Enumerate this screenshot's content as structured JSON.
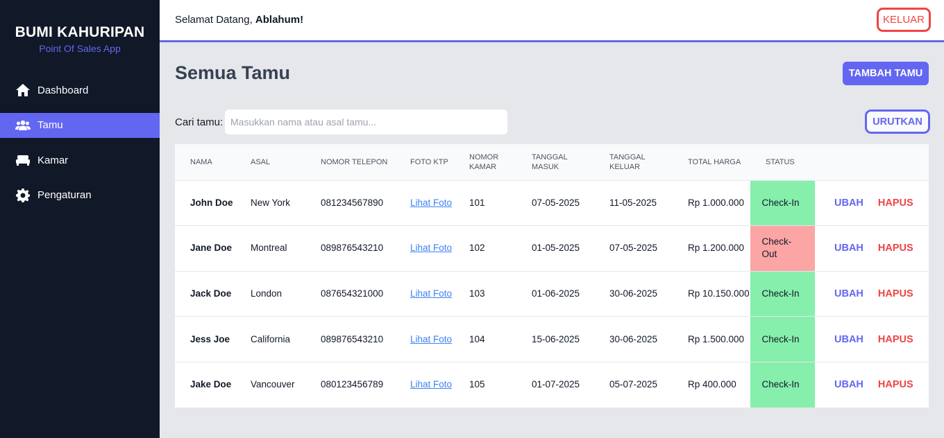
{
  "brand": {
    "title": "BUMI KAHURIPAN",
    "subtitle": "Point Of Sales App"
  },
  "sidebar": {
    "items": [
      {
        "label": "Dashboard",
        "icon": "home-icon",
        "active": false
      },
      {
        "label": "Tamu",
        "icon": "users-icon",
        "active": true
      },
      {
        "label": "Kamar",
        "icon": "bed-icon",
        "active": false
      },
      {
        "label": "Pengaturan",
        "icon": "gear-icon",
        "active": false
      }
    ]
  },
  "header": {
    "greeting_prefix": "Selamat Datang, ",
    "user_name": "Ablahum!",
    "logout_label": "KELUAR"
  },
  "page": {
    "title": "Semua Tamu",
    "add_label": "TAMBAH TAMU",
    "sort_label": "URUTKAN"
  },
  "search": {
    "label": "Cari tamu:",
    "placeholder": "Masukkan nama atau asal tamu...",
    "value": ""
  },
  "table": {
    "columns": [
      "NAMA",
      "ASAL",
      "NOMOR TELEPON",
      "FOTO KTP",
      "NOMOR KAMAR",
      "TANGGAL MASUK",
      "TANGGAL KELUAR",
      "TOTAL HARGA",
      "STATUS",
      ""
    ],
    "rows": [
      {
        "name": "John Doe",
        "origin": "New York",
        "phone": "081234567890",
        "photo": "Lihat Foto",
        "room": "101",
        "check_in": "07-05-2025",
        "check_out": "11-05-2025",
        "total": "Rp 1.000.000",
        "status": "Check-In",
        "status_color": "#86efac",
        "edit": "UBAH",
        "delete": "HAPUS"
      },
      {
        "name": "Jane Doe",
        "origin": "Montreal",
        "phone": "089876543210",
        "photo": "Lihat Foto",
        "room": "102",
        "check_in": "01-05-2025",
        "check_out": "07-05-2025",
        "total": "Rp 1.200.000",
        "status": "Check-Out",
        "status_color": "#fca5a5",
        "edit": "UBAH",
        "delete": "HAPUS"
      },
      {
        "name": "Jack Doe",
        "origin": "London",
        "phone": "087654321000",
        "photo": "Lihat Foto",
        "room": "103",
        "check_in": "01-06-2025",
        "check_out": "30-06-2025",
        "total": "Rp 10.150.000",
        "status": "Check-In",
        "status_color": "#86efac",
        "edit": "UBAH",
        "delete": "HAPUS"
      },
      {
        "name": "Jess Joe",
        "origin": "California",
        "phone": "089876543210",
        "photo": "Lihat Foto",
        "room": "104",
        "check_in": "15-06-2025",
        "check_out": "30-06-2025",
        "total": "Rp 1.500.000",
        "status": "Check-In",
        "status_color": "#86efac",
        "edit": "UBAH",
        "delete": "HAPUS"
      },
      {
        "name": "Jake Doe",
        "origin": "Vancouver",
        "phone": "080123456789",
        "photo": "Lihat Foto",
        "room": "105",
        "check_in": "01-07-2025",
        "check_out": "05-07-2025",
        "total": "Rp 400.000",
        "status": "Check-In",
        "status_color": "#86efac",
        "edit": "UBAH",
        "delete": "HAPUS"
      }
    ]
  },
  "colors": {
    "sidebar_bg": "#111827",
    "accent": "#6366f1",
    "danger": "#ef4444",
    "checkin": "#86efac",
    "checkout": "#fca5a5"
  }
}
